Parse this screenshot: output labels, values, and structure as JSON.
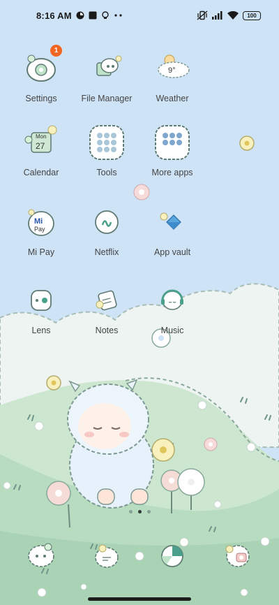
{
  "status_bar": {
    "time": "8:16 AM",
    "battery": "100",
    "icons": [
      "media-icon",
      "stop-icon",
      "bulb-icon",
      "more-dots-icon",
      "vibrate-icon",
      "signal-icon",
      "wifi-icon",
      "battery-icon"
    ]
  },
  "apps": [
    {
      "label": "Settings",
      "icon": "settings-icon",
      "badge": "1"
    },
    {
      "label": "File Manager",
      "icon": "file-manager-icon"
    },
    {
      "label": "Weather",
      "icon": "weather-icon",
      "temp": "9°"
    },
    {
      "label": "Calendar",
      "icon": "calendar-icon",
      "day": "Mon",
      "date": "27"
    },
    {
      "label": "Tools",
      "icon": "tools-folder-icon"
    },
    {
      "label": "More apps",
      "icon": "more-apps-folder-icon"
    },
    {
      "label": "Mi Pay",
      "icon": "mi-pay-icon",
      "glyph": "Mi",
      "sub": "Pay"
    },
    {
      "label": "Netflix",
      "icon": "netflix-icon"
    },
    {
      "label": "App vault",
      "icon": "app-vault-icon"
    },
    {
      "label": "Lens",
      "icon": "lens-icon"
    },
    {
      "label": "Notes",
      "icon": "notes-icon"
    },
    {
      "label": "Music",
      "icon": "music-icon"
    }
  ],
  "page_indicator": {
    "pages": 3,
    "active": 2
  },
  "dock": [
    {
      "icon": "phone-icon"
    },
    {
      "icon": "messages-icon"
    },
    {
      "icon": "browser-icon"
    },
    {
      "icon": "camera-icon"
    }
  ],
  "colors": {
    "sky": "#cfe3f7",
    "grass": "#bfe0c4",
    "badge": "#f26522",
    "outline": "#5f7b74"
  }
}
